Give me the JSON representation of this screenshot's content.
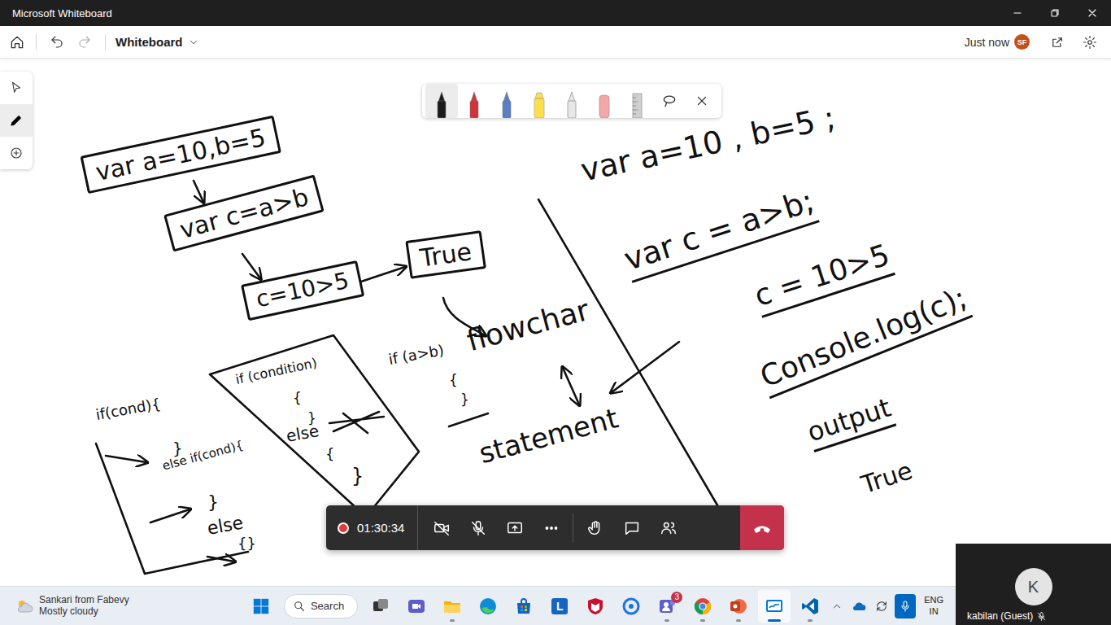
{
  "window": {
    "title": "Microsoft Whiteboard"
  },
  "app_bar": {
    "board_title": "Whiteboard",
    "saved_status": "Just now",
    "user_initials": "SF"
  },
  "tool_rail": [
    {
      "kind": "select",
      "selected": false
    },
    {
      "kind": "pen",
      "selected": true
    },
    {
      "kind": "add",
      "selected": false
    }
  ],
  "pen_toolbar": [
    {
      "kind": "pen",
      "color": "#1b1b1b",
      "selected": true
    },
    {
      "kind": "pen",
      "color": "#d13438",
      "selected": false
    },
    {
      "kind": "pen",
      "color": "#5b7fc7",
      "selected": false
    },
    {
      "kind": "highlighter",
      "color": "#fde047",
      "selected": false
    },
    {
      "kind": "pen",
      "color": "#e8e8e8",
      "selected": false
    },
    {
      "kind": "eraser",
      "color": "#f0a8aa",
      "selected": false
    },
    {
      "kind": "ruler",
      "color": "#cfcfcf",
      "selected": false
    },
    {
      "kind": "lasso",
      "selected": false
    },
    {
      "kind": "close",
      "selected": false
    }
  ],
  "canvas": {
    "boxes": [
      "var a=10,b=5",
      "var c=a>b",
      "c=10>5",
      "True"
    ],
    "notes": [
      "if (condition)",
      "{",
      "}",
      "else",
      "{",
      "}",
      "if (a>b)",
      "{",
      "}",
      "if(cond){",
      "}",
      "else if(cond){",
      "}",
      "else",
      "{}",
      "flowchar",
      "statement",
      "var a=10 , b=5 ;",
      "var c = a>b;",
      "c = 10>5",
      "Console.log(c);",
      "output",
      "True"
    ]
  },
  "call_bar": {
    "recording": true,
    "timer": "01:30:34",
    "camera_on": false,
    "mic_on": false
  },
  "participant": {
    "initial": "K",
    "name": "kabilan (Guest)",
    "muted": true
  },
  "taskbar": {
    "notification": "Sankari from Fabevy",
    "weather": "Mostly cloudy",
    "search": "Search",
    "apps": [
      {
        "kind": "task-view",
        "running": false,
        "selected": false
      },
      {
        "kind": "meet",
        "running": false,
        "selected": false
      },
      {
        "kind": "file-explorer",
        "running": true,
        "selected": false
      },
      {
        "kind": "edge",
        "running": false,
        "selected": false
      },
      {
        "kind": "store",
        "running": false,
        "selected": false
      },
      {
        "kind": "letter-app",
        "logo": "L",
        "running": false,
        "selected": false
      },
      {
        "kind": "mcafee",
        "running": false,
        "selected": false
      },
      {
        "kind": "ring-app",
        "running": false,
        "selected": false
      },
      {
        "kind": "teams",
        "badge": "3",
        "running": true,
        "selected": false
      },
      {
        "kind": "chrome",
        "running": true,
        "selected": false
      },
      {
        "kind": "powerpoint",
        "running": true,
        "selected": false
      },
      {
        "kind": "whiteboard",
        "running": true,
        "selected": true
      },
      {
        "kind": "vscode",
        "running": true,
        "selected": false
      }
    ],
    "tray": {
      "language": "ENG",
      "region": "IN",
      "mic_in_use": true
    }
  }
}
